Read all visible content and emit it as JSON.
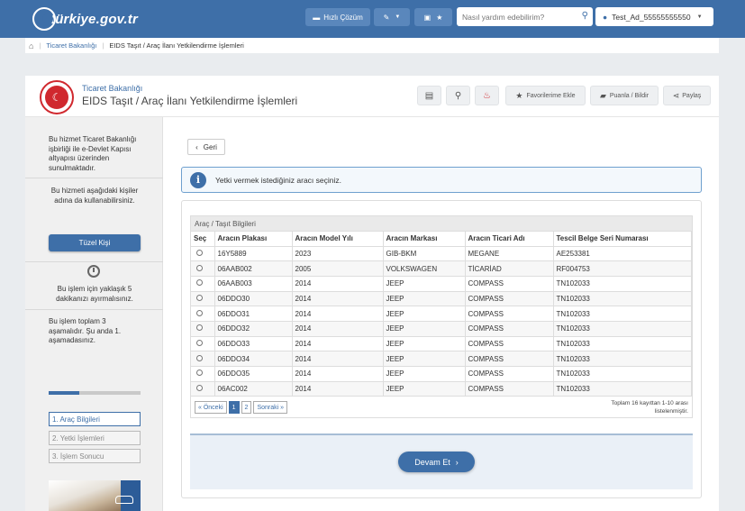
{
  "navbar": {
    "logo_text": "türkiye.gov.tr",
    "quick_solution": "Hızlı Çözüm",
    "search_placeholder": "Nasıl yardım edebilirim?",
    "user_name": "Test_Ad_55555555550",
    "accent": "#3e6fa8"
  },
  "breadcrumb": {
    "items": [
      "Ticaret Bakanlığı",
      "EIDS Taşıt / Araç İlanı Yetkilendirme İşlemleri"
    ]
  },
  "header": {
    "subtitle": "Ticaret Bakanlığı",
    "title": "EIDS Taşıt / Araç İlanı Yetkilendirme İşlemleri",
    "favorites_label": "Favorilerime Ekle",
    "rate_label": "Puanla / Bildir",
    "share_label": "Paylaş"
  },
  "sidebar": {
    "intro": "Bu hizmet Ticaret Bakanlığı işbirliği ile e-Devlet Kapısı altyapısı üzerinden sunulmaktadır.",
    "usable_by": "Bu hizmeti aşağıdaki kişiler adına da kullanabilirsiniz.",
    "legal_entity_button": "Tüzel Kişi",
    "time_note": "Bu işlem için yaklaşık 5 dakikanızı ayırmalısınız.",
    "stage_note": "Bu işlem toplam 3 aşamalıdır. Şu anda 1. aşamadasınız.",
    "progress": 0.33,
    "steps": [
      "1. Araç Bilgileri",
      "2. Yetki İşlemleri",
      "3. İşlem Sonucu"
    ]
  },
  "content": {
    "back_label": "Geri",
    "info_text": "Yetki vermek istediğiniz aracı seçiniz.",
    "table_caption": "Araç / Taşıt Bilgileri",
    "columns": [
      "Seç",
      "Aracın Plakası",
      "Aracın Model Yılı",
      "Aracın Markası",
      "Aracın Ticari Adı",
      "Tescil Belge Seri Numarası"
    ],
    "rows": [
      [
        "16Y5889",
        "2023",
        "GIB-BKM",
        "MEGANE",
        "AE253381"
      ],
      [
        "06AAB002",
        "2005",
        "VOLKSWAGEN",
        "TİCARİAD",
        "RF004753"
      ],
      [
        "06AAB003",
        "2014",
        "JEEP",
        "COMPASS",
        "TN102033"
      ],
      [
        "06DDO30",
        "2014",
        "JEEP",
        "COMPASS",
        "TN102033"
      ],
      [
        "06DDO31",
        "2014",
        "JEEP",
        "COMPASS",
        "TN102033"
      ],
      [
        "06DDO32",
        "2014",
        "JEEP",
        "COMPASS",
        "TN102033"
      ],
      [
        "06DDO33",
        "2014",
        "JEEP",
        "COMPASS",
        "TN102033"
      ],
      [
        "06DDO34",
        "2014",
        "JEEP",
        "COMPASS",
        "TN102033"
      ],
      [
        "06DDO35",
        "2014",
        "JEEP",
        "COMPASS",
        "TN102033"
      ],
      [
        "06AC002",
        "2014",
        "JEEP",
        "COMPASS",
        "TN102033"
      ]
    ],
    "pager": {
      "prev": "« Önceki",
      "pages": [
        "1",
        "2"
      ],
      "next": "Sonraki »",
      "info_line1": "Toplam 16 kayıttan 1-10 arası",
      "info_line2": "listelenmiştir."
    },
    "continue_label": "Devam Et"
  }
}
